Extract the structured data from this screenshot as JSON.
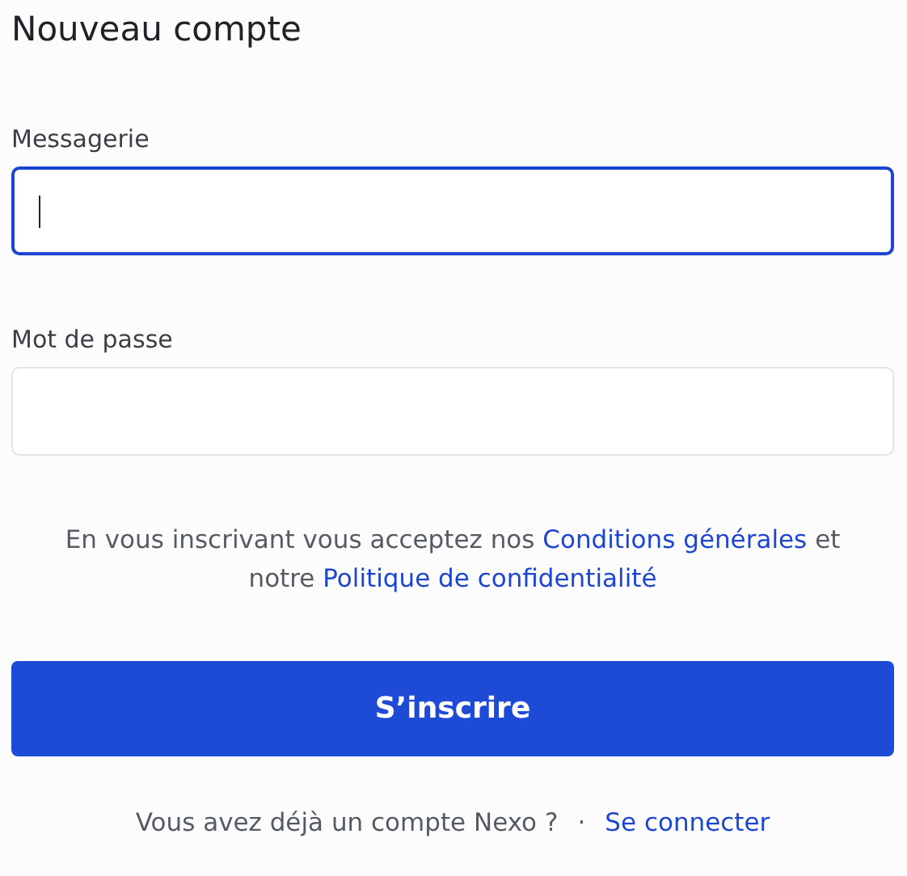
{
  "title": "Nouveau compte",
  "fields": [
    {
      "label": "Messagerie",
      "focused": true
    },
    {
      "label": "Mot de passe",
      "focused": false
    }
  ],
  "terms": [
    {
      "kind": "text",
      "text": "En vous inscrivant vous acceptez nos "
    },
    {
      "kind": "link",
      "text": "Conditions générales"
    },
    {
      "kind": "text",
      "text": " et notre "
    },
    {
      "kind": "link",
      "text": "Politique de confidentialité"
    }
  ],
  "submit_button": "S’inscrire",
  "footer": {
    "question": "Vous avez déjà un compte Nexo ?",
    "separator": "·",
    "link": "Se connecter"
  }
}
